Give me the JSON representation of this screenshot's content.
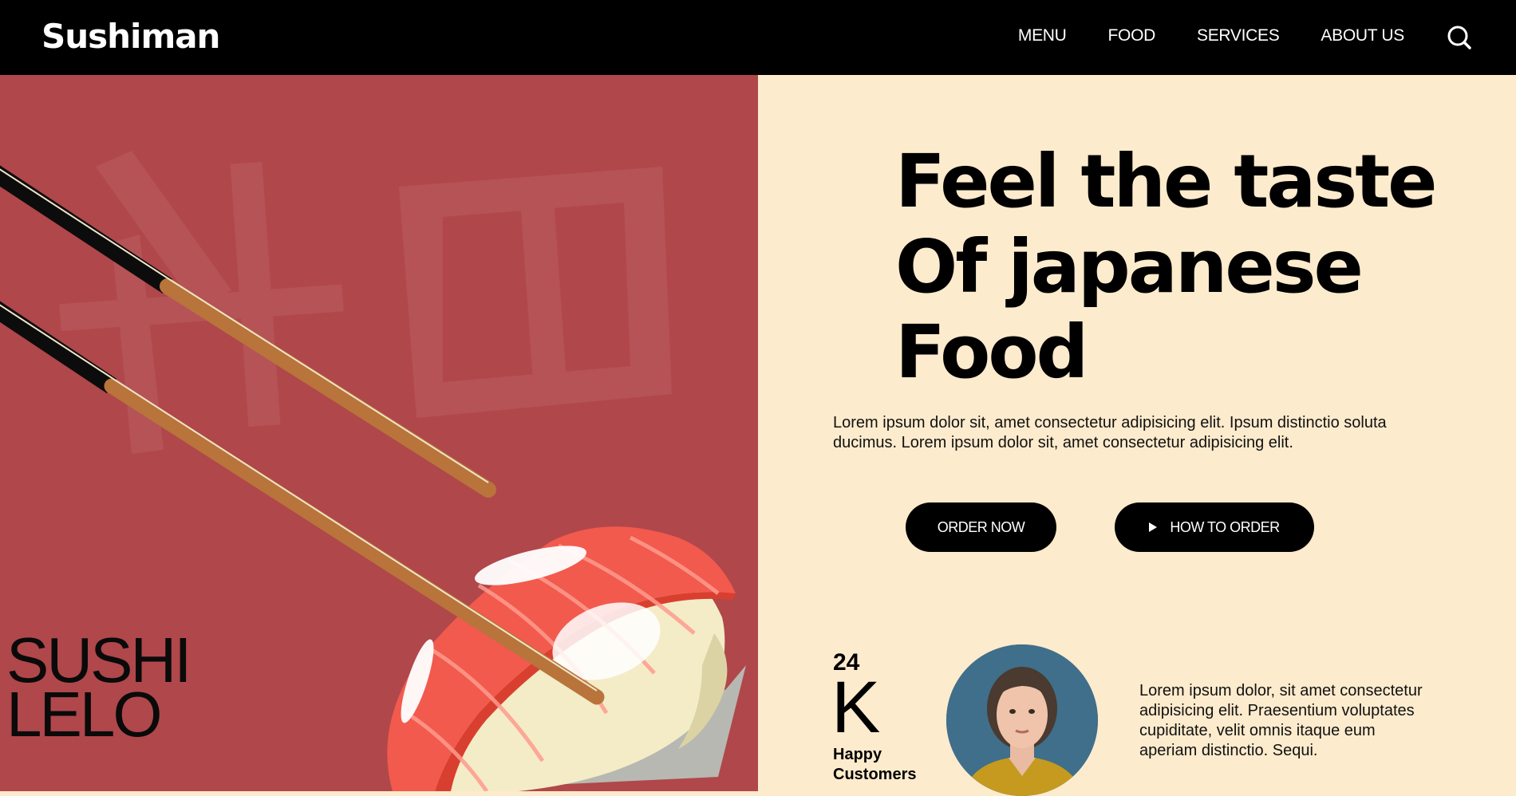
{
  "brand": {
    "name": "Sushiman"
  },
  "nav": {
    "items": [
      {
        "label": "MENU"
      },
      {
        "label": "FOOD"
      },
      {
        "label": "SERVICES"
      },
      {
        "label": "ABOUT US"
      }
    ],
    "search_icon": "search-icon"
  },
  "hero": {
    "headline_lines": [
      "Feel the taste",
      "Of japanese",
      "Food"
    ],
    "intro": "Lorem ipsum dolor sit, amet consectetur adipisicing elit. Ipsum distinctio soluta ducimus. Lorem ipsum dolor sit, amet consectetur adipisicing elit.",
    "buttons": {
      "order_now": "ORDER NOW",
      "how_to_order": "HOW TO ORDER"
    },
    "side_title_lines": [
      "SUSHI",
      "LELO"
    ],
    "kanji_watermark": "料皿"
  },
  "stats": {
    "number": "24",
    "unit": "K",
    "label": "Happy Customers"
  },
  "testimonial": {
    "text": "Lorem ipsum dolor, sit amet consectetur adipisicing elit. Praesentium voluptates cupiditate, velit omnis itaque eum aperiam distinctio. Sequi."
  },
  "colors": {
    "header_bg": "#000000",
    "left_panel_bg": "#b0474b",
    "right_panel_bg": "#fdebcd",
    "button_bg": "#000000",
    "salmon": "#f25a4e",
    "rice": "#f3ecc7"
  }
}
